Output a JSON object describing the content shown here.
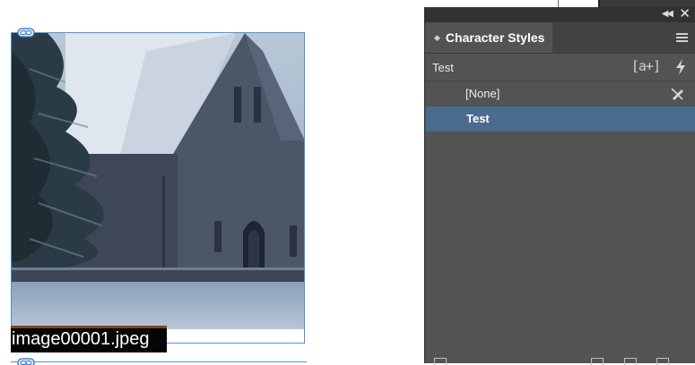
{
  "document": {
    "caption": "image00001.jpeg"
  },
  "panel": {
    "title": "Character Styles",
    "current_style": "Test",
    "new_style_icon": "[a+]",
    "styles": [
      {
        "label": "[None]",
        "selected": false
      },
      {
        "label": "Test",
        "selected": true
      }
    ],
    "colors": {
      "panel_bg": "#535353",
      "selected_row": "#4a6b8e",
      "frame_border": "#4f8fd6"
    },
    "icons": [
      "panel-collapse-icon",
      "panel-close-icon",
      "panel-menu-icon",
      "new-style-icon",
      "quick-apply-icon",
      "no-edit-icon",
      "link-icon"
    ]
  }
}
